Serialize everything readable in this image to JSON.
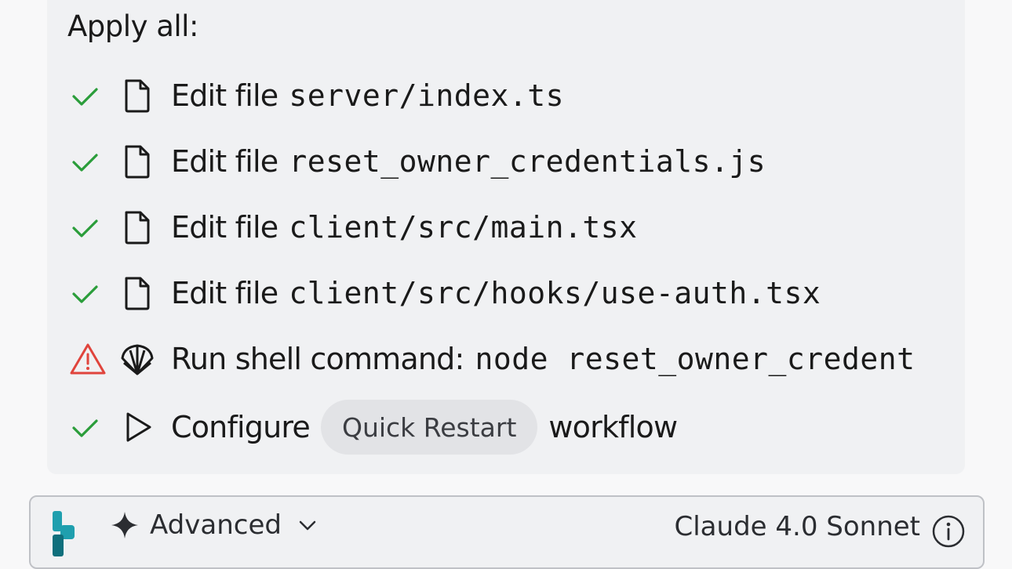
{
  "checkpoint": {
    "heading": "Apply all:",
    "actions": [
      {
        "status": "done",
        "kind": "file-icon",
        "label": "Edit file",
        "target": "server/index.ts"
      },
      {
        "status": "done",
        "kind": "file-icon",
        "label": "Edit file",
        "target": "reset_owner_credentials.js"
      },
      {
        "status": "done",
        "kind": "file-icon",
        "label": "Edit file",
        "target": "client/src/main.tsx"
      },
      {
        "status": "done",
        "kind": "file-icon",
        "label": "Edit file",
        "target": "client/src/hooks/use-auth.tsx"
      },
      {
        "status": "warning",
        "kind": "shell-icon",
        "label": "Run shell command:",
        "target": "node reset_owner_credent"
      },
      {
        "status": "done",
        "kind": "play-icon",
        "label": "Configure",
        "pill": "Quick Restart",
        "suffix": "workflow"
      }
    ]
  },
  "composer": {
    "mode_label": "Advanced",
    "model_label": "Claude 4.0 Sonnet"
  },
  "colors": {
    "success": "#2a9d3a",
    "warning": "#e0443c",
    "brand_teal": "#1f9fae"
  }
}
